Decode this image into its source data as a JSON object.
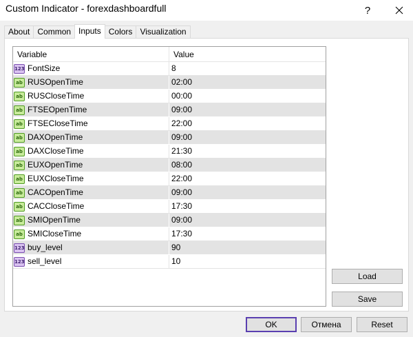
{
  "window": {
    "title": "Custom Indicator - forexdashboardfull",
    "help_label": "?"
  },
  "tabs": [
    {
      "label": "About"
    },
    {
      "label": "Common"
    },
    {
      "label": "Inputs"
    },
    {
      "label": "Colors"
    },
    {
      "label": "Visualization"
    }
  ],
  "active_tab": "Inputs",
  "grid": {
    "headers": {
      "variable": "Variable",
      "value": "Value"
    },
    "rows": [
      {
        "type_icon": "123",
        "variable": "FontSize",
        "value": "8"
      },
      {
        "type_icon": "ab",
        "variable": "RUSOpenTime",
        "value": "02:00"
      },
      {
        "type_icon": "ab",
        "variable": "RUSCloseTime",
        "value": "00:00"
      },
      {
        "type_icon": "ab",
        "variable": "FTSEOpenTime",
        "value": "09:00"
      },
      {
        "type_icon": "ab",
        "variable": "FTSECloseTime",
        "value": "22:00"
      },
      {
        "type_icon": "ab",
        "variable": "DAXOpenTime",
        "value": "09:00"
      },
      {
        "type_icon": "ab",
        "variable": "DAXCloseTime",
        "value": "21:30"
      },
      {
        "type_icon": "ab",
        "variable": "EUXOpenTime",
        "value": "08:00"
      },
      {
        "type_icon": "ab",
        "variable": "EUXCloseTime",
        "value": "22:00"
      },
      {
        "type_icon": "ab",
        "variable": "CACOpenTime",
        "value": "09:00"
      },
      {
        "type_icon": "ab",
        "variable": "CACCloseTime",
        "value": "17:30"
      },
      {
        "type_icon": "ab",
        "variable": "SMIOpenTime",
        "value": "09:00"
      },
      {
        "type_icon": "ab",
        "variable": "SMICloseTime",
        "value": "17:30"
      },
      {
        "type_icon": "123",
        "variable": "buy_level",
        "value": "90"
      },
      {
        "type_icon": "123",
        "variable": "sell_level",
        "value": "10"
      }
    ]
  },
  "side_buttons": {
    "load": "Load",
    "save": "Save"
  },
  "footer_buttons": {
    "ok": "OK",
    "cancel": "Отмена",
    "reset": "Reset"
  },
  "colors": {
    "accent_border": "#5a3fb0",
    "shaded_row": "#e3e3e3"
  }
}
